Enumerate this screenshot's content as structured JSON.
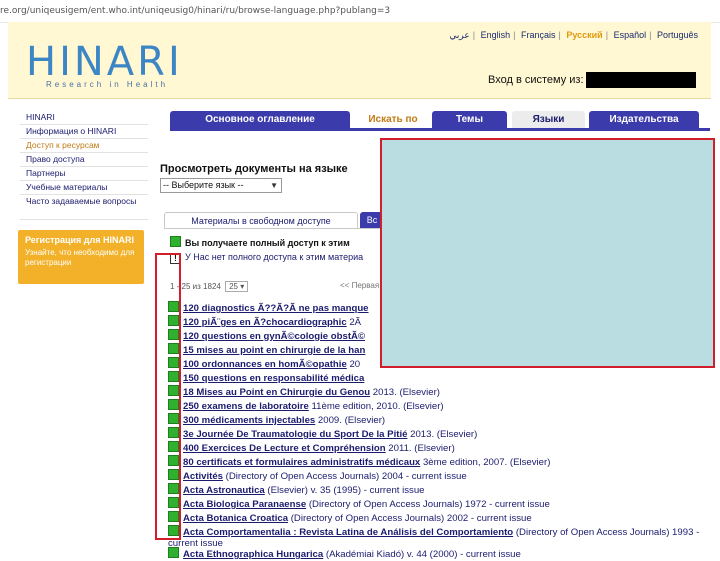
{
  "browser": {
    "url": "re.org/uniqeusigem/ent.who.int/uniqeusig0/hinari/ru/browse-language.php?publang=3"
  },
  "languages": [
    "عربي",
    "English",
    "Français",
    "Русский",
    "Español",
    "Português"
  ],
  "active_language": "Русский",
  "logo": {
    "main": "HINARI",
    "sub": "Research in Health"
  },
  "login": {
    "label": "Вход в систему из:"
  },
  "sidebar": {
    "items": [
      "HINARI",
      "Информация о HINARI",
      "Доступ к ресурсам",
      "Право доступа",
      "Партнеры",
      "Учебные материалы",
      "Часто задаваемые вопросы"
    ],
    "current": "Доступ к ресурсам",
    "registration": {
      "title": "Регистрация для HINARI",
      "note": "Узнайте, что необходимо для регистрации"
    }
  },
  "tabs": [
    "Основное оглавление",
    "Искать по",
    "Темы",
    "Языки",
    "Издательства"
  ],
  "page_heading": "Просмотреть документы на языке",
  "language_select": {
    "value": "-- Выберите язык --"
  },
  "main_tabs": [
    "Материалы в свободном доступе",
    "Вс"
  ],
  "legend": [
    {
      "icon": "green-square",
      "text": "Вы получаете полный доступ к этим"
    },
    {
      "icon": "exclamation-square",
      "text": "У Нас нет полного доступа к этим материа"
    }
  ],
  "pager": {
    "range": "1 - 25 из 1824",
    "per_page": "25",
    "middle": "<< Первая"
  },
  "journals": [
    {
      "title": "120 diagnostics Ã??Ã?Ã  ne pas manque",
      "rest": ""
    },
    {
      "title": "120 piÃ¨ges en Ã?chocardiographic",
      "rest": " 2Ã"
    },
    {
      "title": "120 questions en gynÃ©cologie obstÃ©",
      "rest": ""
    },
    {
      "title": "15 mises au point en chirurgie de la han",
      "rest": ""
    },
    {
      "title": "100 ordonnances en homÃ©opathie",
      "rest": " 20"
    },
    {
      "title": "150 questions en responsabilité médica",
      "rest": ""
    },
    {
      "title": "18 Mises au Point en Chirurgie du Genou",
      "rest": " 2013. (Elsevier)"
    },
    {
      "title": "250 examens de laboratoire",
      "rest": " 11ème edition, 2010. (Elsevier)"
    },
    {
      "title": "300 médicaments injectables",
      "rest": " 2009. (Elsevier)"
    },
    {
      "title": "3e Journée De Traumatologie du Sport De la Pitié",
      "rest": " 2013. (Elsevier)"
    },
    {
      "title": "400 Exercices De Lecture et Compréhension",
      "rest": " 2011. (Elsevier)"
    },
    {
      "title": "80 certificats et formulaires administratifs médicaux",
      "rest": " 3ème edition, 2007. (Elsevier)"
    },
    {
      "title": "Activités",
      "rest": " (Directory of Open Access Journals) 2004 - current issue"
    },
    {
      "title": "Acta Astronautica",
      "rest": " (Elsevier) v. 35 (1995) - current issue"
    },
    {
      "title": "Acta Biologica Paranaense",
      "rest": " (Directory of Open Access Journals) 1972 - current issue"
    },
    {
      "title": "Acta Botanica Croatica",
      "rest": " (Directory of Open Access Journals) 2002 - current issue"
    },
    {
      "title": "Acta Comportamentalia : Revista Latina de Análisis del Comportamiento",
      "rest": " (Directory of Open Access Journals) 1993 - current issue"
    },
    {
      "title": "Acta Ethnographica Hungarica",
      "rest": " (Akadémiai Kiadó) v. 44 (2000) - current issue"
    }
  ],
  "colors": {
    "nav_blue": "#3b3bab",
    "accent_orange": "#f2b128",
    "overlay": "#b9dde0",
    "highlight_red": "#d21e2a",
    "access_green": "#2fb02f"
  }
}
